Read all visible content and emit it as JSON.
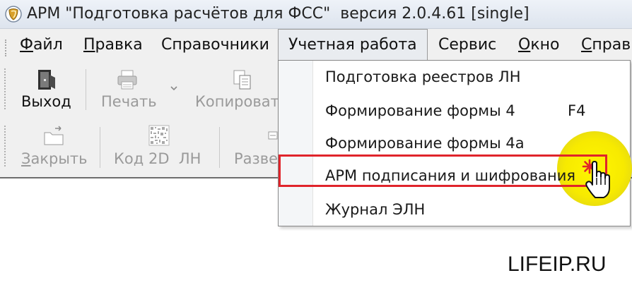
{
  "window": {
    "title": "АРМ \"Подготовка расчётов для ФСС\"  версия 2.0.4.61 [single]",
    "icon": "app-shield-icon"
  },
  "menubar": {
    "items": [
      {
        "label": "Файл",
        "accel": "Ф",
        "rest": "айл"
      },
      {
        "label": "Правка",
        "accel": "П",
        "rest": "равка"
      },
      {
        "label": "Справочники"
      },
      {
        "label": "Учетная работа",
        "open": true
      },
      {
        "label": "Сервис"
      },
      {
        "label": "Окно",
        "accel": "О",
        "rest": "кно"
      },
      {
        "label": "Справка",
        "accel": "С",
        "rest": "правк"
      }
    ]
  },
  "toolbar": {
    "row1": [
      {
        "label": "Выход",
        "icon": "door-exit-icon",
        "enabled": true
      },
      {
        "label": "Печать",
        "icon": "printer-icon",
        "enabled": false
      },
      {
        "label": "Копироват",
        "icon": "copy-icon",
        "enabled": false
      }
    ],
    "row2": [
      {
        "label": "Закрыть",
        "accel": "З",
        "rest": "акрыть",
        "icon": "folder-close-icon",
        "enabled": false
      },
      {
        "label": "Код 2D  ЛН",
        "icon": "qr-code-icon",
        "enabled": false
      },
      {
        "label": "Разве",
        "icon": "expand-icon",
        "enabled": false
      }
    ]
  },
  "dropdown": {
    "items": [
      {
        "label": "Подготовка реестров ЛН",
        "shortcut": ""
      },
      {
        "label": "Формирование формы 4",
        "shortcut": "F4"
      },
      {
        "label": "Формирование формы 4а",
        "shortcut": ""
      },
      {
        "label": "АРМ подписания и шифрования",
        "shortcut": "",
        "highlighted": true
      },
      {
        "label": "Журнал ЭЛН",
        "shortcut": ""
      }
    ]
  },
  "watermark": "LIFEIP.RU",
  "colors": {
    "highlight_box": "#e0242b",
    "spotlight": "#f7ea00",
    "menu_bg": "#f0f0f0"
  }
}
